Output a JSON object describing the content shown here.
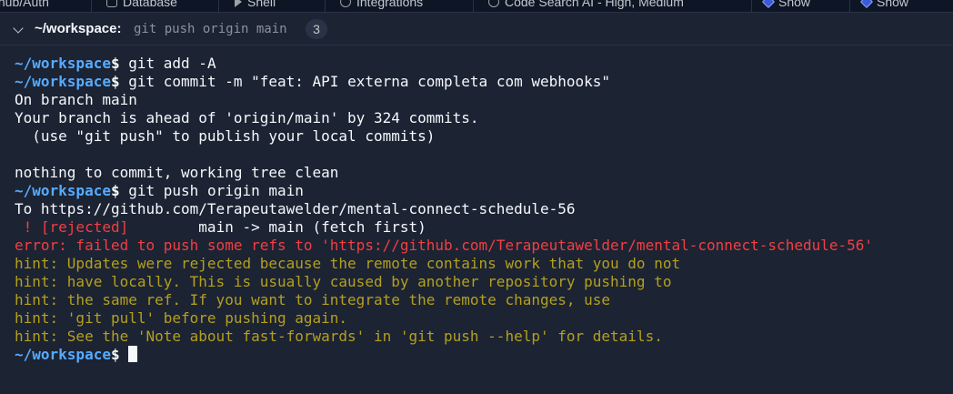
{
  "tabs": [
    {
      "label": "Github/Auth",
      "icon": "square-icon"
    },
    {
      "label": "Database",
      "icon": "database-icon"
    },
    {
      "label": "Shell",
      "icon": "play-icon"
    },
    {
      "label": "Integrations",
      "icon": "integrations-icon"
    },
    {
      "label": "Code Search AI - High, Medium",
      "icon": "search-icon"
    },
    {
      "label": "Show",
      "icon": "diamond-icon"
    },
    {
      "label": "Show",
      "icon": "diamond-icon"
    }
  ],
  "header": {
    "path": "~/workspace:",
    "command": "git push origin main",
    "badge": "3"
  },
  "terminal": {
    "prompt": "~/workspace",
    "dollar": "$",
    "lines": [
      {
        "type": "cmd",
        "text": " git add -A"
      },
      {
        "type": "cmd",
        "text": " git commit -m \"feat: API externa completa com webhooks\""
      },
      {
        "type": "out",
        "text": "On branch main"
      },
      {
        "type": "out",
        "text": "Your branch is ahead of 'origin/main' by 324 commits."
      },
      {
        "type": "out",
        "text": "  (use \"git push\" to publish your local commits)"
      },
      {
        "type": "out",
        "text": ""
      },
      {
        "type": "out",
        "text": "nothing to commit, working tree clean"
      },
      {
        "type": "cmd",
        "text": " git push origin main"
      },
      {
        "type": "out",
        "text": "To https://github.com/Terapeutawelder/mental-connect-schedule-56"
      },
      {
        "type": "rejected",
        "red": " ! [rejected]",
        "rest": "        main -> main (fetch first)"
      },
      {
        "type": "error",
        "text": "error: failed to push some refs to 'https://github.com/Terapeutawelder/mental-connect-schedule-56'"
      },
      {
        "type": "hint",
        "text": "hint: Updates were rejected because the remote contains work that you do not"
      },
      {
        "type": "hint",
        "text": "hint: have locally. This is usually caused by another repository pushing to"
      },
      {
        "type": "hint",
        "text": "hint: the same ref. If you want to integrate the remote changes, use"
      },
      {
        "type": "hint",
        "text": "hint: 'git pull' before pushing again."
      },
      {
        "type": "hint",
        "text": "hint: See the 'Note about fast-forwards' in 'git push --help' for details."
      },
      {
        "type": "prompt-cursor",
        "text": " "
      }
    ]
  },
  "colors": {
    "background": "#1c2333",
    "prompt": "#57abff",
    "error": "#f23f42",
    "hint": "#b3a01f"
  }
}
